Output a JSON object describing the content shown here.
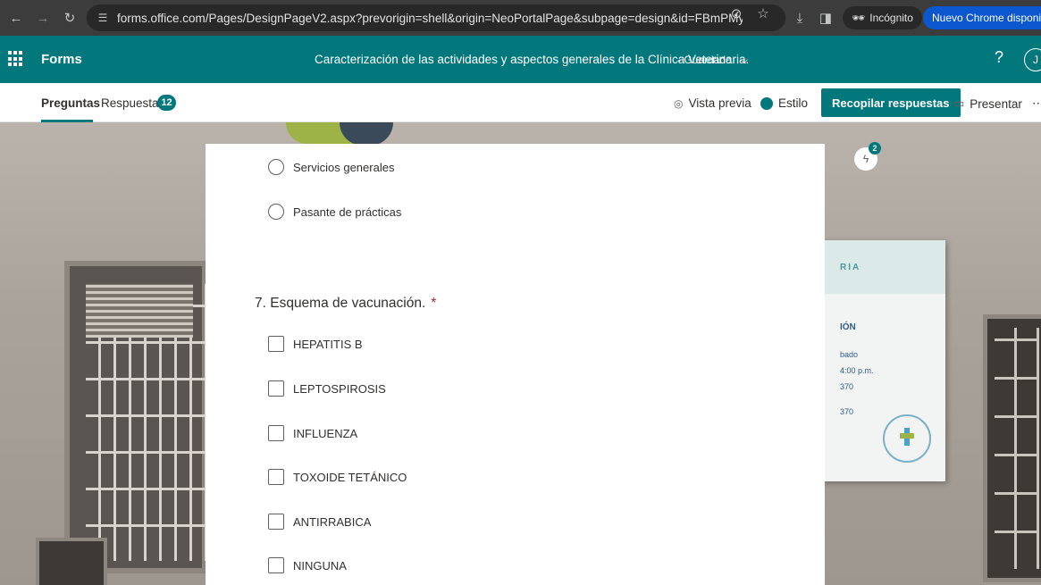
{
  "browser": {
    "url": "forms.office.com/Pages/DesignPageV2.aspx?prevorigin=shell&origin=NeoPortalPage&subpage=design&id=FBmPMytfHkyU4bKTR8e...",
    "incognito_label": "Incógnito",
    "update_label": "Nuevo Chrome disponible"
  },
  "header": {
    "app_name": "Forms",
    "form_title": "Caracterización de las actividades y aspectos generales de la Clínica Veterinaria.",
    "save_status": "- Guardado",
    "help": "?",
    "avatar_initial": "J"
  },
  "tabs": {
    "questions": "Preguntas",
    "responses": "Respuestas",
    "responses_count": "12"
  },
  "toolbar": {
    "preview": "Vista previa",
    "style": "Estilo",
    "collect": "Recopilar respuestas",
    "present": "Presentar",
    "more": "⋯"
  },
  "background_sign": {
    "text_1": "RIA",
    "text_2": "IÓN",
    "line_1": "bado",
    "line_2": "4:00 p.m.",
    "line_3": "370",
    "line_4": "370"
  },
  "ideas_badge": {
    "count": "2"
  },
  "form": {
    "prev_options": [
      "Servicios generales",
      "Pasante de prácticas"
    ],
    "question": {
      "number_text": "7. Esquema de vacunación.",
      "required_mark": "*",
      "options": [
        "HEPATITIS B",
        "LEPTOSPIROSIS",
        "INFLUENZA",
        "TOXOIDE TETÁNICO",
        "ANTIRRABICA",
        "NINGUNA"
      ]
    }
  }
}
